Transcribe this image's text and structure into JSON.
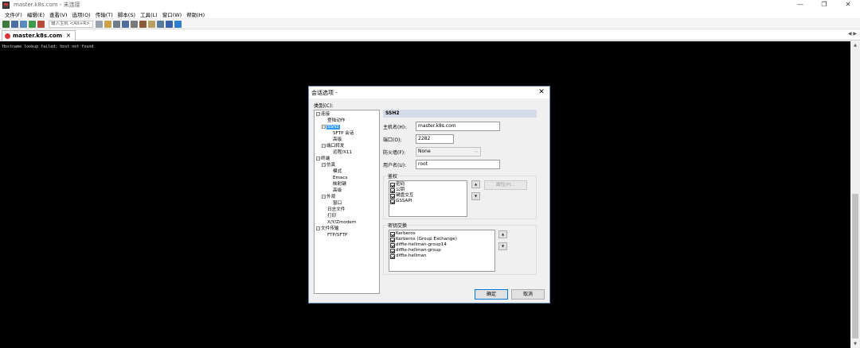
{
  "window": {
    "title": "master.k8s.com - 未连接",
    "controls": [
      "—",
      "❐",
      "✕"
    ]
  },
  "menubar": [
    "文件(F)",
    "编辑(E)",
    "查看(V)",
    "选项(O)",
    "传输(T)",
    "脚本(S)",
    "工具(L)",
    "窗口(W)",
    "帮助(H)"
  ],
  "toolbar": {
    "host_input_placeholder": "输入主机 <Alt+R>"
  },
  "tab": {
    "label": "master.k8s.com",
    "close": "✕",
    "nav": "◀ ▶"
  },
  "terminal": {
    "output": "Hostname lookup failed: host not found"
  },
  "scrollbar": {
    "up": "▲",
    "down": "▼"
  },
  "dialog": {
    "title": "会话选项 -",
    "close": "✕",
    "category_label": "类别(C):",
    "tree": [
      {
        "label": "连接",
        "toggle": "−"
      },
      {
        "label": "登陆动作",
        "toggle": ""
      },
      {
        "label": "SSH2",
        "toggle": "−"
      },
      {
        "label": "SFTP 会话",
        "toggle": ""
      },
      {
        "label": "高级",
        "toggle": ""
      },
      {
        "label": "端口转发",
        "toggle": "−"
      },
      {
        "label": "远程/X11",
        "toggle": ""
      },
      {
        "label": "终端",
        "toggle": "−"
      },
      {
        "label": "仿真",
        "toggle": "−"
      },
      {
        "label": "模式",
        "toggle": ""
      },
      {
        "label": "Emacs",
        "toggle": ""
      },
      {
        "label": "映射键",
        "toggle": ""
      },
      {
        "label": "高级",
        "toggle": ""
      },
      {
        "label": "外观",
        "toggle": "−"
      },
      {
        "label": "窗口",
        "toggle": ""
      },
      {
        "label": "日志文件",
        "toggle": ""
      },
      {
        "label": "打印",
        "toggle": ""
      },
      {
        "label": "X/Y/Zmodem",
        "toggle": ""
      },
      {
        "label": "文件传输",
        "toggle": "−"
      },
      {
        "label": "FTP/SFTP",
        "toggle": ""
      }
    ],
    "section": "SSH2",
    "fields": {
      "hostname_label": "主机名(H):",
      "hostname_value": "master.k8s.com",
      "port_label": "端口(O):",
      "port_value": "2282",
      "firewall_label": "防火墙(F):",
      "firewall_value": "None",
      "username_label": "用户名(U):",
      "username_value": "root"
    },
    "auth": {
      "title": "鉴权",
      "items": [
        "密码",
        "公钥",
        "键盘交互",
        "GSSAPI"
      ],
      "up": "▲",
      "down": "▼",
      "properties_button": "属性(P)..."
    },
    "kex": {
      "title": "密钥交换",
      "items": [
        "Kerberos",
        "Kerberos (Group Exchange)",
        "diffie-hellman-group14",
        "diffie-hellman-group",
        "diffie-hellman"
      ],
      "up": "▲",
      "down": "▼"
    },
    "ok_button": "确定",
    "cancel_button": "取消"
  }
}
